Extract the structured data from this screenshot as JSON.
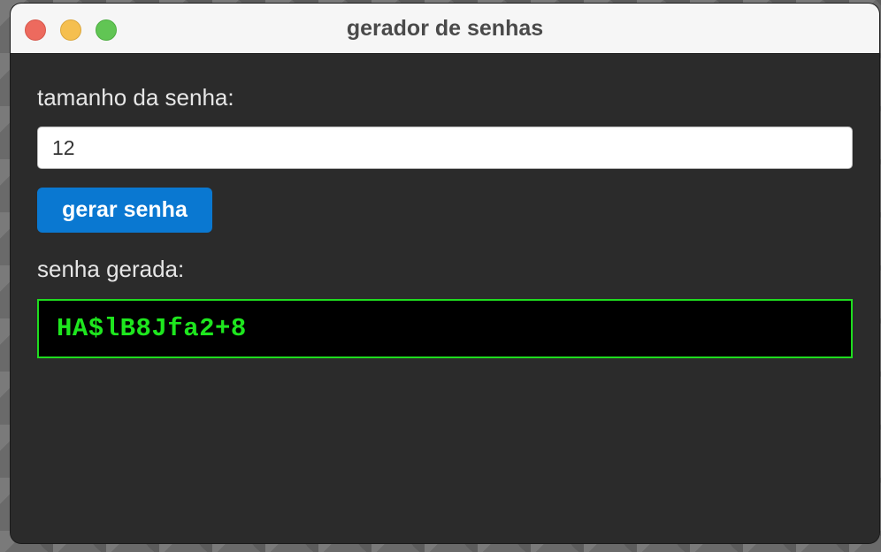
{
  "window": {
    "title": "gerador de senhas",
    "controls": {
      "close": "close-button",
      "minimize": "minimize-button",
      "maximize": "maximize-button"
    }
  },
  "form": {
    "size_label": "tamanho da senha:",
    "size_value": "12",
    "generate_button_label": "gerar senha",
    "result_label": "senha gerada:",
    "generated_password": "HA$lB8Jfa2+8"
  },
  "colors": {
    "accent_button": "#0a78d1",
    "password_text": "#1ee61e",
    "password_border": "#1fdc1f",
    "window_background": "#2b2b2b",
    "traffic_close": "#ed6a5e",
    "traffic_minimize": "#f5bf4f",
    "traffic_maximize": "#61c554"
  }
}
